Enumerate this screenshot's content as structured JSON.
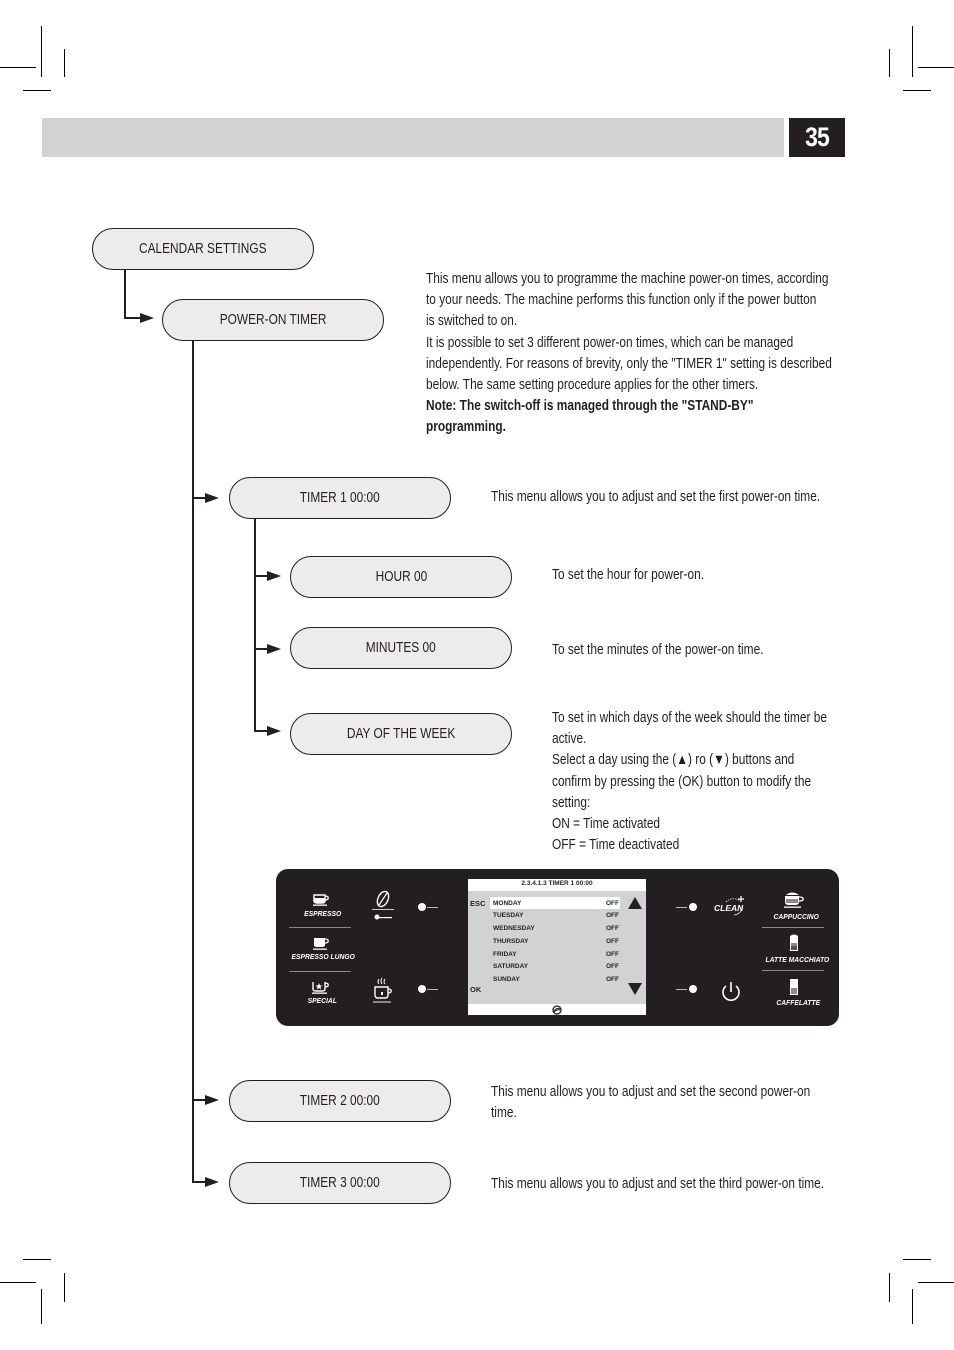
{
  "header": {
    "page_number": "35"
  },
  "tree": {
    "calendar_settings": "CALENDAR SETTINGS",
    "power_on_timer": "POWER-ON TIMER",
    "timer1": "TIMER 1  00:00",
    "hour": "HOUR 00",
    "minutes": "MINUTES 00",
    "day_of_week": "DAY OF THE WEEK",
    "timer2": "TIMER 2  00:00",
    "timer3": "TIMER 3  00:00"
  },
  "descriptions": {
    "intro_lines": [
      "This menu allows you to programme the machine power-on times, according",
      "to your needs. The machine performs this function only if the power button",
      "is switched to on.",
      "It is possible to set 3 different power-on times, which can be managed",
      "independently. For reasons of brevity, only the \"TIMER 1\" setting is described",
      "below. The same setting procedure applies for the other timers."
    ],
    "note_lines": [
      "Note: The switch-off is managed through the \"STAND-BY\"",
      "programming."
    ],
    "timer1": "This menu allows you to adjust and set the first power-on time.",
    "hour": "To set the hour for power-on.",
    "minutes": "To set the minutes of the power-on time.",
    "day_lines": [
      "To set in which days of the week should the timer be",
      "active.",
      "Select a day using the  (▲) ro (▼) buttons and",
      "confirm by pressing the (OK) button to modify the",
      "setting:",
      "ON = Time activated",
      "OFF = Time deactivated"
    ],
    "timer2_lines": [
      "This menu allows you to adjust and set the second power-on",
      "time."
    ],
    "timer3": "This menu allows you to adjust and set the third power-on time."
  },
  "panel": {
    "left_buttons": [
      "ESPRESSO",
      "ESPRESSO LUNGO",
      "SPECIAL"
    ],
    "right_buttons": [
      "CAPPUCCINO",
      "LATTE MACCHIATO",
      "CAFFELATTE"
    ],
    "clean_label": "CLEAN",
    "screen": {
      "title": "2.3.4.1.3 TIMER 1 00:00",
      "esc": "ESC",
      "ok": "OK",
      "days": [
        {
          "name": "MONDAY",
          "value": "OFF"
        },
        {
          "name": "TUESDAY",
          "value": "OFF"
        },
        {
          "name": "WEDNESDAY",
          "value": "OFF"
        },
        {
          "name": "THURSDAY",
          "value": "OFF"
        },
        {
          "name": "FRIDAY",
          "value": "OFF"
        },
        {
          "name": "SATURDAY",
          "value": "OFF"
        },
        {
          "name": "SUNDAY",
          "value": "OFF"
        }
      ],
      "selected_day": "MONDAY"
    }
  },
  "colors": {
    "header_gray": "#d1d2d4",
    "pill_fill": "#ececed",
    "ink": "#231f20",
    "panel_bg": "#231f20"
  }
}
